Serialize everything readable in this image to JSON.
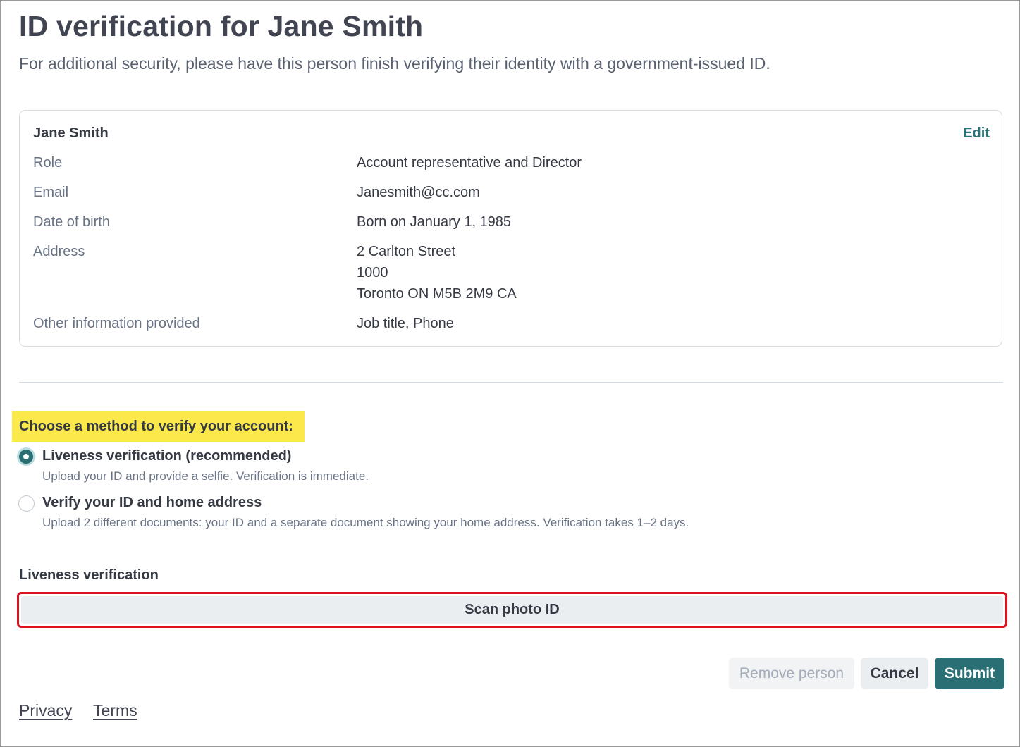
{
  "header": {
    "title": "ID verification for Jane Smith",
    "subtitle": "For additional security, please have this person finish verifying their identity with a government-issued ID."
  },
  "person_card": {
    "name": "Jane Smith",
    "edit_label": "Edit",
    "rows": [
      {
        "label": "Role",
        "value": "Account representative and Director"
      },
      {
        "label": "Email",
        "value": "Janesmith@cc.com"
      },
      {
        "label": "Date of birth",
        "value": "Born on January 1, 1985"
      },
      {
        "label": "Address",
        "value_lines": [
          "2 Carlton Street",
          "1000",
          "Toronto ON M5B 2M9 CA"
        ]
      },
      {
        "label": "Other information provided",
        "value": "Job title, Phone"
      }
    ]
  },
  "verification_method": {
    "prompt": "Choose a method to verify your account:",
    "options": [
      {
        "title": "Liveness verification (recommended)",
        "description": "Upload your ID and provide a selfie. Verification is immediate.",
        "selected": true
      },
      {
        "title": "Verify your ID and home address",
        "description": "Upload 2 different documents: your ID and a separate document showing your home address. Verification takes 1–2 days.",
        "selected": false
      }
    ]
  },
  "liveness_section": {
    "heading": "Liveness verification",
    "scan_button_label": "Scan photo ID"
  },
  "actions": {
    "remove_label": "Remove person",
    "cancel_label": "Cancel",
    "submit_label": "Submit"
  },
  "footer": {
    "privacy_label": "Privacy",
    "terms_label": "Terms"
  },
  "colors": {
    "accent": "#2a6f73",
    "highlight": "#fbe84b",
    "annotation_outline": "#e0111f"
  }
}
